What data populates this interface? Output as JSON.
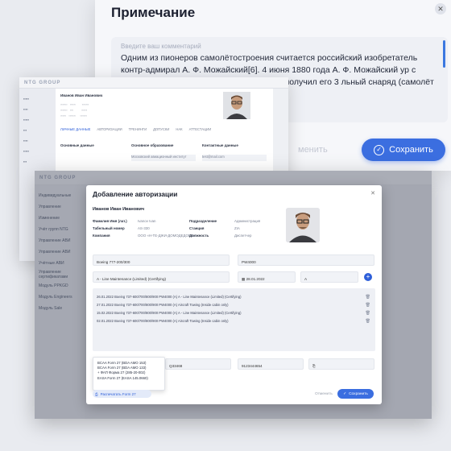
{
  "note": {
    "title": "Примечание",
    "placeholder": "Введите ваш комментарий",
    "text": "Одним из пионеров самолётостроения считается российский изобретатель контр-адмирал А. Ф. Можайский[6]. 4 июня 1880 года А. Ф. Можайский                          ур с просьбой о выдаче ему                   льный снаряд» и получил его 3                   льный снаряд (самолёт                   ичину в 1882 году. Не",
    "cancel": "менить",
    "save": "Сохранить"
  },
  "window2": {
    "logo": "NTG GROUP",
    "person": "Иванов Иван Иванович",
    "tabs": [
      "ЛИЧНЫЕ ДАННЫЕ",
      "АВТОРИЗАЦИИ",
      "ТРЕНИНГИ",
      "ДОПУСКИ",
      "НАК",
      "АТТЕСТАЦИИ"
    ],
    "sections": [
      "Основные данные",
      "Основное образование",
      "Контактные данные"
    ],
    "email": "test@mail.com",
    "school": "Московский авиационный институт"
  },
  "window3": {
    "logo": "NTG GROUP",
    "sidebar": [
      "Индивидуальные",
      "Управление",
      "Изменение",
      "Учёт групп NTG",
      "Управление АВИ",
      "Управление АВИ",
      "Учётные АВИ",
      "Управление сертификатами",
      "Модуль PPKGD",
      "Модуль Engineers",
      "Модуль Sale"
    ]
  },
  "modal": {
    "title": "Добавление авторизации",
    "person": "Иванов Иван Иванович",
    "left_fields": [
      {
        "k": "Фамилия Имя (лат.)",
        "v": "Ivanov Ivan"
      },
      {
        "k": "Табельный номер",
        "v": "AS-330"
      },
      {
        "k": "Компания",
        "v": "ООО «Н-ТЕ-ДЖИ-ДОМОДЕДОВО»"
      }
    ],
    "right_fields": [
      {
        "k": "Подразделение",
        "v": "Администрация"
      },
      {
        "k": "Станция",
        "v": "ZIA"
      },
      {
        "k": "Должность",
        "v": "Диспетчер"
      }
    ],
    "aircraft": "Boeing 777-200/300",
    "engine": "PW4000",
    "organisation": "A - Line Maintenance (Limited) (Certifying)",
    "date": "28.01.2022",
    "category": "A",
    "rows": [
      "26.01.2022 Boeing 737-600/700/800/900 PW4000 (A) A - Line Maintenance (Limited) (Certifying)",
      "27.01.2022 Boeing 737-600/700/800/900 PW4000 (A) Aircraft Towing (Inside cabin only)",
      "15.02.2022 Boeing 737-600/700/800/900 PW4000 (A) A - Line Maintenance (Limited) (Certifying)",
      "02.01.2022 Boeing 737-600/700/800/900 PW4000 (A) Aircraft Towing (Inside cabin only)"
    ],
    "field_a": "Q33468",
    "field_b": "9123444654",
    "dropdown": [
      "BCAA Form 27 (BDA AMO 153)",
      "BCAA Form 27 (BDA AMO 133)",
      "+ ФАП Форма 27 (285-20-002)",
      "EASA Form 27 (EASA 145.0660)"
    ],
    "chip": "Распечатать Form 27",
    "cancel": "Отменить",
    "save": "Сохранить",
    "accent": "#3b6ee0"
  }
}
